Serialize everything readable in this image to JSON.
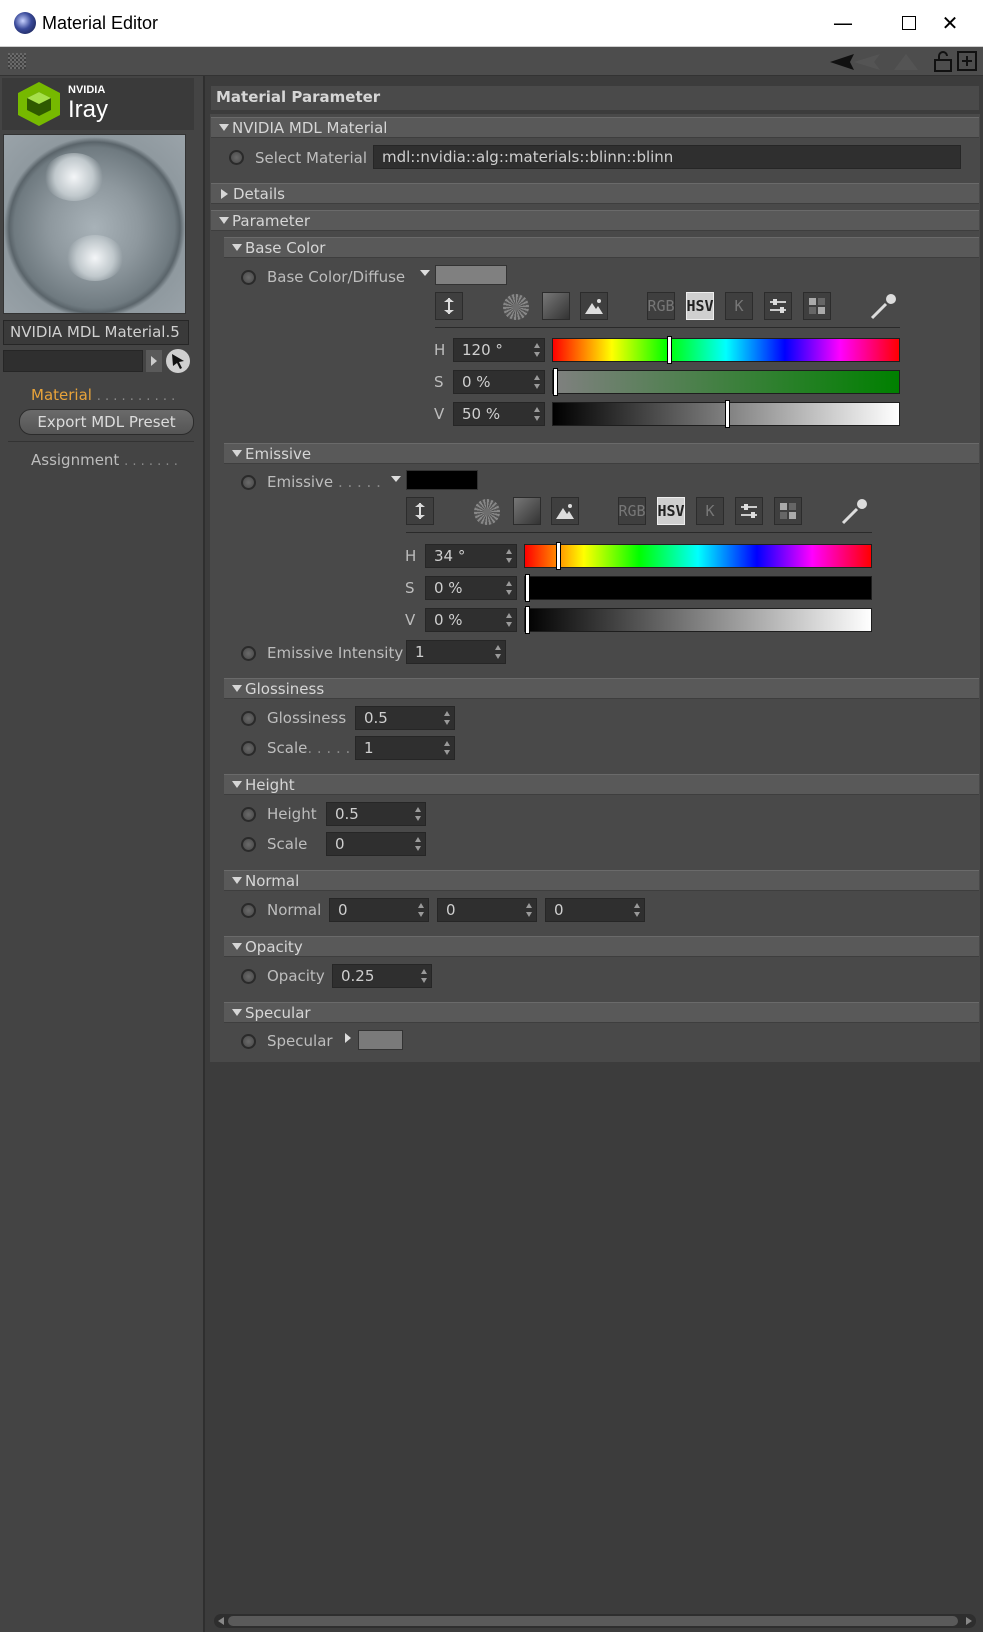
{
  "window": {
    "title": "Material Editor",
    "controls": {
      "minimize": "—",
      "maximize": "☐",
      "close": "✕"
    }
  },
  "sidebar": {
    "logo": {
      "brand": "NVIDIA",
      "product": "Iray"
    },
    "material_name": "NVIDIA MDL Material.5",
    "nav_material": "Material",
    "nav_material_dots": ". . . . . . . . . .",
    "export_button": "Export MDL Preset",
    "nav_assignment": "Assignment",
    "nav_assignment_dots": ". . . . . . .",
    "active_color": "#e8a33a"
  },
  "main": {
    "section_title": "Material Parameter",
    "mdl_group": {
      "title": "NVIDIA MDL Material",
      "select_label": "Select Material",
      "select_value": "mdl::nvidia::alg::materials::blinn::blinn"
    },
    "details": {
      "title": "Details"
    },
    "parameter": {
      "title": "Parameter"
    },
    "base_color": {
      "title": "Base Color",
      "label": "Base Color/Diffuse",
      "swatch_color": "#808080",
      "modes": [
        "RGB",
        "HSV",
        "K"
      ],
      "active_mode": "HSV",
      "h": {
        "label": "H",
        "value": "120 °",
        "fraction": 0.333
      },
      "s": {
        "label": "S",
        "value": "0 %",
        "fraction": 0.0
      },
      "v": {
        "label": "V",
        "value": "50 %",
        "fraction": 0.5
      },
      "s_gradient_end": "#008000"
    },
    "emissive": {
      "title": "Emissive",
      "label": "Emissive",
      "label_dots": ". . . . .",
      "swatch_color": "#000000",
      "modes": [
        "RGB",
        "HSV",
        "K"
      ],
      "active_mode": "HSV",
      "h": {
        "label": "H",
        "value": "34 °",
        "fraction": 0.094
      },
      "s": {
        "label": "S",
        "value": "0 %",
        "fraction": 0.0
      },
      "v": {
        "label": "V",
        "value": "0 %",
        "fraction": 0.0
      },
      "intensity_label": "Emissive Intensity",
      "intensity_value": "1"
    },
    "glossiness": {
      "title": "Glossiness",
      "gloss_label": "Glossiness",
      "gloss_value": "0.5",
      "scale_label": "Scale",
      "scale_dots": ". . . . .",
      "scale_value": "1"
    },
    "height": {
      "title": "Height",
      "height_label": "Height",
      "height_value": "0.5",
      "scale_label": "Scale",
      "scale_value": "0"
    },
    "normal": {
      "title": "Normal",
      "label": "Normal",
      "values": [
        "0",
        "0",
        "0"
      ]
    },
    "opacity": {
      "title": "Opacity",
      "label": "Opacity",
      "value": "0.25"
    },
    "specular": {
      "title": "Specular",
      "label": "Specular",
      "swatch_color": "#7a7a7a"
    }
  }
}
